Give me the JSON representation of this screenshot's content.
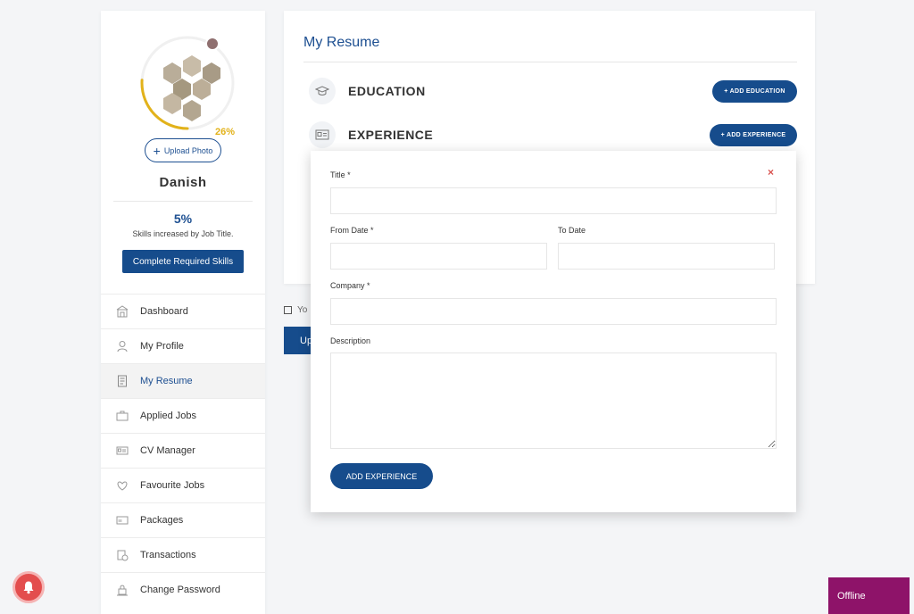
{
  "profile": {
    "completion_label": "26%",
    "completion_fraction": 0.26,
    "upload_label": "Upload Photo",
    "name": "Danish",
    "status_color": "#8f6f6f"
  },
  "skills": {
    "percent": "5%",
    "text": "Skills increased by Job Title.",
    "button": "Complete Required Skills"
  },
  "nav": {
    "items": [
      {
        "label": "Dashboard",
        "icon": "dashboard-icon",
        "active": false
      },
      {
        "label": "My Profile",
        "icon": "user-icon",
        "active": false
      },
      {
        "label": "My Resume",
        "icon": "document-icon",
        "active": true
      },
      {
        "label": "Applied Jobs",
        "icon": "briefcase-icon",
        "active": false
      },
      {
        "label": "CV Manager",
        "icon": "id-card-icon",
        "active": false
      },
      {
        "label": "Favourite Jobs",
        "icon": "heart-icon",
        "active": false
      },
      {
        "label": "Packages",
        "icon": "package-icon",
        "active": false
      },
      {
        "label": "Transactions",
        "icon": "transactions-icon",
        "active": false
      },
      {
        "label": "Change Password",
        "icon": "lock-icon",
        "active": false
      }
    ]
  },
  "resume": {
    "title": "My Resume",
    "education": {
      "title": "EDUCATION",
      "button": "+ ADD EDUCATION",
      "icon": "graduation-cap-icon"
    },
    "experience": {
      "title": "EXPERIENCE",
      "button": "+ ADD EXPERIENCE",
      "icon": "id-card-icon"
    },
    "checkbox_text": "Yo",
    "update_button": "Up"
  },
  "modal": {
    "close": "×",
    "title_label": "Title *",
    "from_label": "From Date *",
    "to_label": "To Date",
    "company_label": "Company *",
    "description_label": "Description",
    "submit": "ADD EXPERIENCE"
  },
  "chat": {
    "status": "Offline"
  },
  "colors": {
    "primary": "#164c8c",
    "accent": "#e2b21a",
    "chat": "#8e1369",
    "bell": "#e34d4d",
    "close": "#d9534f"
  }
}
